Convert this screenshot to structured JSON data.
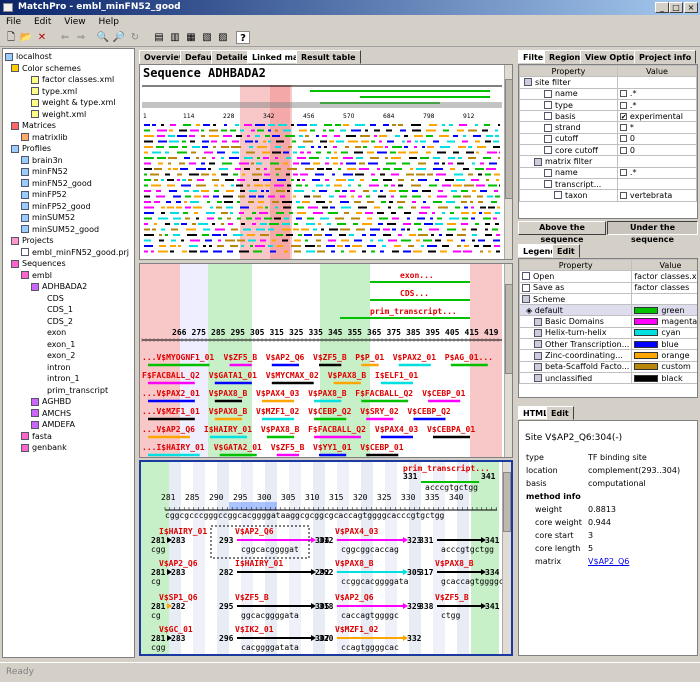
{
  "window": {
    "title": "MatchPro - embl_minFN52_good"
  },
  "menu": [
    "File",
    "Edit",
    "View",
    "Help"
  ],
  "tree": {
    "root": "localhost",
    "color_schemes": {
      "label": "Color schemes",
      "files": [
        "factor classes.xml",
        "type.xml",
        "weight & type.xml",
        "weight.xml"
      ]
    },
    "matrices": {
      "label": "Matrices",
      "items": [
        "matrixlib"
      ]
    },
    "profiles": {
      "label": "Profiles",
      "items": [
        "brain3n",
        "minFN52",
        "minFN52_good",
        "minFP52",
        "minFP52_good",
        "minSUM52",
        "minSUM52_good"
      ]
    },
    "projects": {
      "label": "Projects",
      "items": [
        "embl_minFN52_good.prj"
      ]
    },
    "sequences": {
      "label": "Sequences",
      "embl": "embl",
      "adhbada2": "ADHBADA2",
      "adh_children": [
        "CDS",
        "CDS_1",
        "CDS_2",
        "exon",
        "exon_1",
        "exon_2",
        "intron",
        "intron_1",
        "prim_transcript"
      ],
      "others": [
        "AGHBD",
        "AMCHS",
        "AMDEFA"
      ],
      "fasta": "fasta",
      "genbank": "genbank"
    }
  },
  "center_tabs": [
    "Overview",
    "Default",
    "Detailed",
    "Linked map",
    "Result table"
  ],
  "sequence_title": "Sequence ADHBADA2",
  "overview_ticks": [
    "1",
    "114",
    "228",
    "342",
    "456",
    "570",
    "684",
    "798",
    "912"
  ],
  "linked": {
    "features": [
      "exon...",
      "CDS...",
      "prim_transcript..."
    ],
    "ticks": [
      "266",
      "275",
      "285",
      "295",
      "305",
      "315",
      "325",
      "335",
      "345",
      "355",
      "365",
      "375",
      "385",
      "395",
      "405",
      "415",
      "419"
    ],
    "rows": [
      [
        "...V$MYOGNF1_01",
        "V$ZF5_B",
        "V$AP2_Q6",
        "V$ZF5_B",
        "P$P_01",
        "V$PAX2_01",
        "P$AG_01..."
      ],
      [
        "F$FACBALL_Q2",
        "V$GATA1_01",
        "V$MYCMAX_02",
        "V$PAX8_B",
        "I$ELF1_01"
      ],
      [
        "...V$PAX2_01",
        "V$PAX8_B",
        "V$PAX4_03",
        "V$PAX8_B",
        "F$FACBALL_Q2",
        "V$CEBP_01"
      ],
      [
        "...V$MZF1_01",
        "V$PAX8_B",
        "V$MZF1_02",
        "V$CEBP_Q2",
        "V$SRY_02",
        "V$CEBP_Q2"
      ],
      [
        "...V$AP2_Q6",
        "I$HAIRY_01",
        "V$PAX8_B",
        "F$FACBALL_Q2",
        "V$PAX4_03",
        "V$CEBPA_01"
      ],
      [
        "...I$HAIRY_01",
        "V$GATA2_01",
        "V$ZF5_B",
        "V$YY1_01",
        "V$CEBP_01"
      ]
    ]
  },
  "detail": {
    "feature": "prim_transcript...",
    "feature_range": [
      "331",
      "341"
    ],
    "feature_seq": "acccgtgctgg",
    "ticks": [
      "281",
      "285",
      "290",
      "295",
      "300",
      "305",
      "310",
      "315",
      "320",
      "325",
      "330",
      "335",
      "340"
    ],
    "sequence_line": "cggcgcccgggccggcacggggataaggcgcggcgcaccagtggggcacccgtgctgg",
    "sites": [
      {
        "name": "I$HAIRY_01",
        "start": "281",
        "end": "283",
        "seq": "cgg"
      },
      {
        "name": "V$AP2_Q6",
        "start": "293",
        "end": "304",
        "seq": "cggcacggggat"
      },
      {
        "name": "V$PAX4_03",
        "start": "312",
        "end": "323",
        "seq": "cggcggcaccag"
      },
      {
        "name": "",
        "start": "331",
        "end": "341",
        "seq": "acccgtgctgg"
      },
      {
        "name": "V$AP2_Q6",
        "start": "281",
        "end": "283",
        "seq": "cg"
      },
      {
        "name": "I$HAIRY_01",
        "start": "282",
        "end": "292",
        "seq": ""
      },
      {
        "name": "V$PAX8_B",
        "start": "292",
        "end": "305",
        "seq": "ccggcacggggata"
      },
      {
        "name": "V$PAX8_B",
        "start": "317",
        "end": "334",
        "seq": "gcaccagtggggcaccc"
      },
      {
        "name": "V$SP1_Q6",
        "start": "281",
        "end": "282",
        "seq": "cg"
      },
      {
        "name": "V$ZF5_B",
        "start": "295",
        "end": "305",
        "seq": "ggcacggggata"
      },
      {
        "name": "V$AP2_Q6",
        "start": "318",
        "end": "329",
        "seq": "caccagtggggc"
      },
      {
        "name": "V$ZF5_B",
        "start": "338",
        "end": "341",
        "seq": "ctgg"
      },
      {
        "name": "V$GC_01",
        "start": "281",
        "end": "283",
        "seq": "cgg"
      },
      {
        "name": "V$IK2_01",
        "start": "296",
        "end": "307",
        "seq": "cacggggatata"
      },
      {
        "name": "V$MZF1_02",
        "start": "320",
        "end": "332",
        "seq": "ccagtggggcac"
      },
      {
        "name": "",
        "start": "",
        "end": "",
        "seq": ""
      }
    ]
  },
  "filter_tabs": [
    "Filter",
    "Regions",
    "View Options",
    "Project info"
  ],
  "filter_table": {
    "headers": [
      "Property",
      "Value"
    ],
    "rows": [
      {
        "p": "site filter",
        "v": "",
        "check": false,
        "level": 0
      },
      {
        "p": "name",
        "v": ".*",
        "check": true,
        "level": 2
      },
      {
        "p": "type",
        "v": ".*",
        "check": true,
        "level": 2
      },
      {
        "p": "basis",
        "v": "experimental",
        "check": true,
        "checked": true,
        "level": 2
      },
      {
        "p": "strand",
        "v": "*",
        "check": true,
        "level": 2
      },
      {
        "p": "cutoff",
        "v": "0",
        "check": true,
        "level": 2
      },
      {
        "p": "core cutoff",
        "v": "0",
        "check": true,
        "level": 2
      },
      {
        "p": "matrix filter",
        "v": "",
        "check": false,
        "level": 1
      },
      {
        "p": "name",
        "v": ".*",
        "check": true,
        "level": 2
      },
      {
        "p": "transcript...",
        "v": "",
        "check": false,
        "level": 2
      },
      {
        "p": "taxon",
        "v": "vertebrata",
        "check": true,
        "level": 3
      }
    ]
  },
  "filter_buttons": [
    "Above the sequence",
    "Under the sequence"
  ],
  "legend_tabs": [
    "Legend",
    "Edit"
  ],
  "legend": {
    "headers": [
      "Property",
      "Value"
    ],
    "open": {
      "label": "Open",
      "value": "factor classes.xml"
    },
    "save": {
      "label": "Save as",
      "value": "factor classes"
    },
    "scheme": "Scheme",
    "default": {
      "label": "default",
      "color_name": "green",
      "color": "#00c000"
    },
    "items": [
      {
        "label": "Basic Domains",
        "color_name": "magenta",
        "color": "#ff00ff"
      },
      {
        "label": "Helix-turn-helix",
        "color_name": "cyan",
        "color": "#00e0e0"
      },
      {
        "label": "Other Transcription...",
        "color_name": "blue",
        "color": "#0000ff"
      },
      {
        "label": "Zinc-coordinating...",
        "color_name": "orange",
        "color": "#ffa500"
      },
      {
        "label": "beta-Scaffold Facto...",
        "color_name": "custom",
        "color": "#b8860b"
      },
      {
        "label": "unclassified",
        "color_name": "black",
        "color": "#000000"
      }
    ]
  },
  "html_tabs": [
    "HTML",
    "Edit"
  ],
  "site_info": {
    "title": "Site V$AP2_Q6:304(-)",
    "rows": [
      {
        "k": "type",
        "v": "TF binding site"
      },
      {
        "k": "location",
        "v": "complement(293..304)"
      },
      {
        "k": "basis",
        "v": "computational"
      }
    ],
    "method_info": "method info",
    "method_rows": [
      {
        "k": "weight",
        "v": "0.8813"
      },
      {
        "k": "core weight",
        "v": "0.944"
      },
      {
        "k": "core start",
        "v": "3"
      },
      {
        "k": "core length",
        "v": "5"
      },
      {
        "k": "matrix",
        "v": "V$AP2_Q6",
        "link": true
      }
    ]
  },
  "status": "Ready"
}
